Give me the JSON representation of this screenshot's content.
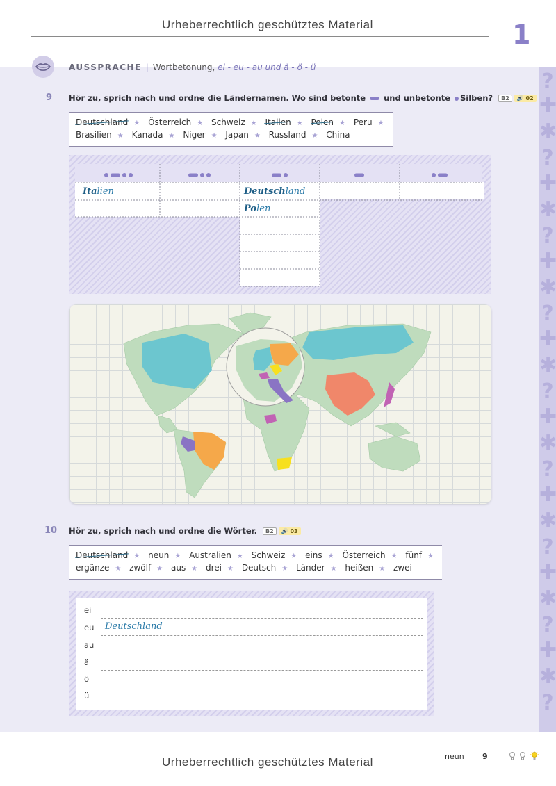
{
  "watermark": "Urheberrechtlich geschütztes Material",
  "chapter_number": "1",
  "section": {
    "title": "AUSSPRACHE",
    "sep": "|",
    "subtitle": "Wortbetonung,",
    "vowels": "ei - eu - au und ä - ö - ü"
  },
  "ex9": {
    "number": "9",
    "instruction_a": "Hör zu, sprich nach und ordne die Ländernamen. Wo sind betonte",
    "instruction_b": "und unbetonte",
    "instruction_c": "Silben?",
    "level": "B2",
    "audio": "02",
    "words_row1": [
      "Deutschland",
      "Österreich",
      "Schweiz",
      "Italien",
      "Polen",
      "Peru"
    ],
    "words_row2": [
      "Brasilien",
      "Kanada",
      "Niger",
      "Japan",
      "Russland",
      "China"
    ],
    "crossed": [
      "Deutschland",
      "Italien",
      "Polen"
    ],
    "table": {
      "patterns": [
        "●▬●●",
        "▬●●",
        "▬●",
        "▬",
        "●▬"
      ],
      "col1": [
        "Italien",
        ""
      ],
      "col3": [
        "Deutschland",
        "Polen",
        "",
        "",
        "",
        ""
      ],
      "col1_stressed": [
        "Ita",
        "lien"
      ],
      "col3_stressed": [
        [
          "Deutsch",
          "land"
        ],
        [
          "Po",
          "len"
        ]
      ]
    }
  },
  "ex10": {
    "number": "10",
    "instruction": "Hör zu, sprich nach und ordne die Wörter.",
    "level": "B2",
    "audio": "03",
    "words_row1": [
      "Deutschland",
      "neun",
      "Australien",
      "Schweiz",
      "eins",
      "Österreich",
      "fünf"
    ],
    "words_row2": [
      "ergänze",
      "zwölf",
      "aus",
      "drei",
      "Deutsch",
      "Länder",
      "heißen",
      "zwei"
    ],
    "crossed": [
      "Deutschland"
    ],
    "rows": [
      {
        "label": "ei",
        "answer": ""
      },
      {
        "label": "eu",
        "answer": "Deutschland"
      },
      {
        "label": "au",
        "answer": ""
      },
      {
        "label": "ä",
        "answer": ""
      },
      {
        "label": "ö",
        "answer": ""
      },
      {
        "label": "ü",
        "answer": ""
      }
    ]
  },
  "footer": {
    "page_word": "neun",
    "page_number": "9",
    "difficulty_icons": [
      "bulb-outline",
      "bulb-outline",
      "bulb-lit"
    ]
  },
  "colors": {
    "band": "#ecebf6",
    "accent": "#8a80c8",
    "land": "#bfdcbd",
    "teal": "#6cc6cf",
    "orange": "#f5a84a",
    "coral": "#f0876a",
    "purple": "#8a74c4",
    "magenta": "#c163b4",
    "yellow": "#f7e01e"
  },
  "icons": {
    "section": "lips-icon",
    "audio": "speaker-icon"
  }
}
